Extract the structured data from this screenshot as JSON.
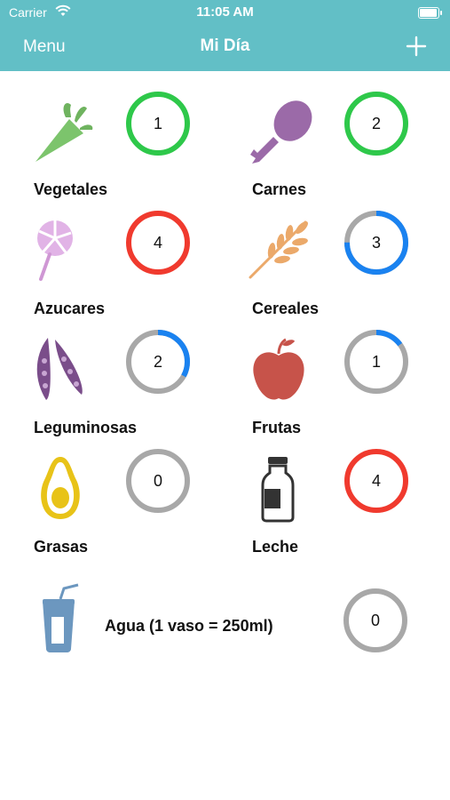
{
  "status": {
    "carrier": "Carrier",
    "time": "11:05 AM"
  },
  "nav": {
    "menu": "Menu",
    "title": "Mi Día",
    "add_icon": "plus-icon"
  },
  "colors": {
    "header": "#62bfc6",
    "green": "#2ec84a",
    "red": "#f03a2e",
    "blue": "#1a82f0",
    "gray": "#a8a8a8"
  },
  "items": [
    {
      "label": "Vegetales",
      "count": "1",
      "icon": "carrot-icon",
      "progress": 1.0,
      "color": "green"
    },
    {
      "label": "Carnes",
      "count": "2",
      "icon": "drumstick-icon",
      "progress": 1.0,
      "color": "green"
    },
    {
      "label": "Azucares",
      "count": "4",
      "icon": "lollipop-icon",
      "progress": 1.0,
      "color": "red"
    },
    {
      "label": "Cereales",
      "count": "3",
      "icon": "wheat-icon",
      "progress": 0.75,
      "color": "blue"
    },
    {
      "label": "Leguminosas",
      "count": "2",
      "icon": "pea-pod-icon",
      "progress": 0.33,
      "color": "blue"
    },
    {
      "label": "Frutas",
      "count": "1",
      "icon": "apple-icon",
      "progress": 0.15,
      "color": "blue"
    },
    {
      "label": "Grasas",
      "count": "0",
      "icon": "avocado-icon",
      "progress": 0.0,
      "color": "gray"
    },
    {
      "label": "Leche",
      "count": "4",
      "icon": "milk-bottle-icon",
      "progress": 1.0,
      "color": "red"
    }
  ],
  "agua": {
    "label": "Agua (1 vaso = 250ml)",
    "count": "0",
    "icon": "cup-icon",
    "progress": 0.0,
    "color": "gray"
  }
}
